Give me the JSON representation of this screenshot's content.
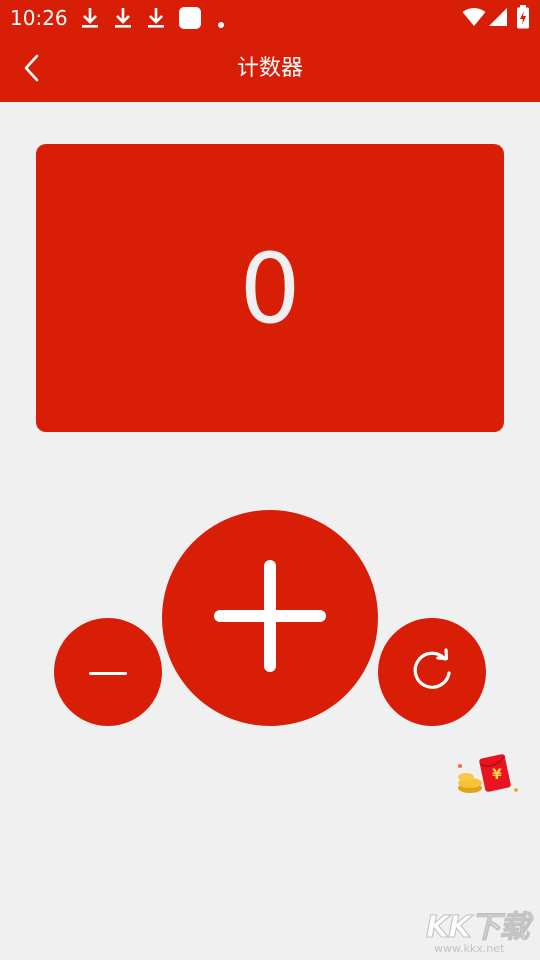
{
  "status_bar": {
    "time": "10:26",
    "icons": [
      "download-icon",
      "download-icon",
      "download-icon",
      "app-notification-icon",
      "dot-icon",
      "wifi-icon",
      "signal-icon",
      "battery-charging-icon"
    ]
  },
  "app_bar": {
    "title": "计数器",
    "back_icon": "chevron-left-icon"
  },
  "counter": {
    "value": "0"
  },
  "controls": {
    "minus_icon": "minus-icon",
    "plus_icon": "plus-icon",
    "reset_icon": "refresh-icon"
  },
  "floating": {
    "redpacket_icon": "red-envelope-icon",
    "redpacket_symbol": "¥"
  },
  "watermark": {
    "text": "KK下载",
    "url": "www.kkx.net"
  },
  "colors": {
    "primary": "#d81e06",
    "background": "#f0f0f0",
    "on_primary": "#ffffff"
  }
}
